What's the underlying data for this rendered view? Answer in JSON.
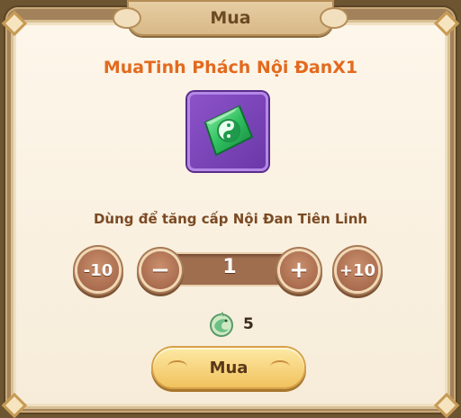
{
  "dialog": {
    "title": "Mua",
    "heading": "MuaTinh Phách Nội ĐanX1",
    "item_icon": "green-yin-yang-gem-icon",
    "description": "Dùng để tăng cấp Nội Đan Tiên Linh"
  },
  "quantity": {
    "minus10_label": "-10",
    "minus_label": "−",
    "value": "1",
    "plus_label": "+",
    "plus10_label": "+10"
  },
  "cost": {
    "currency_icon": "jade-dragon-coin-icon",
    "amount": "5"
  },
  "buy_button_label": "Mua",
  "colors": {
    "heading": "#e36a1e",
    "item_frame": "#7a43b8",
    "round_button": "#a9694b",
    "buy_button": "#f6d47e"
  }
}
